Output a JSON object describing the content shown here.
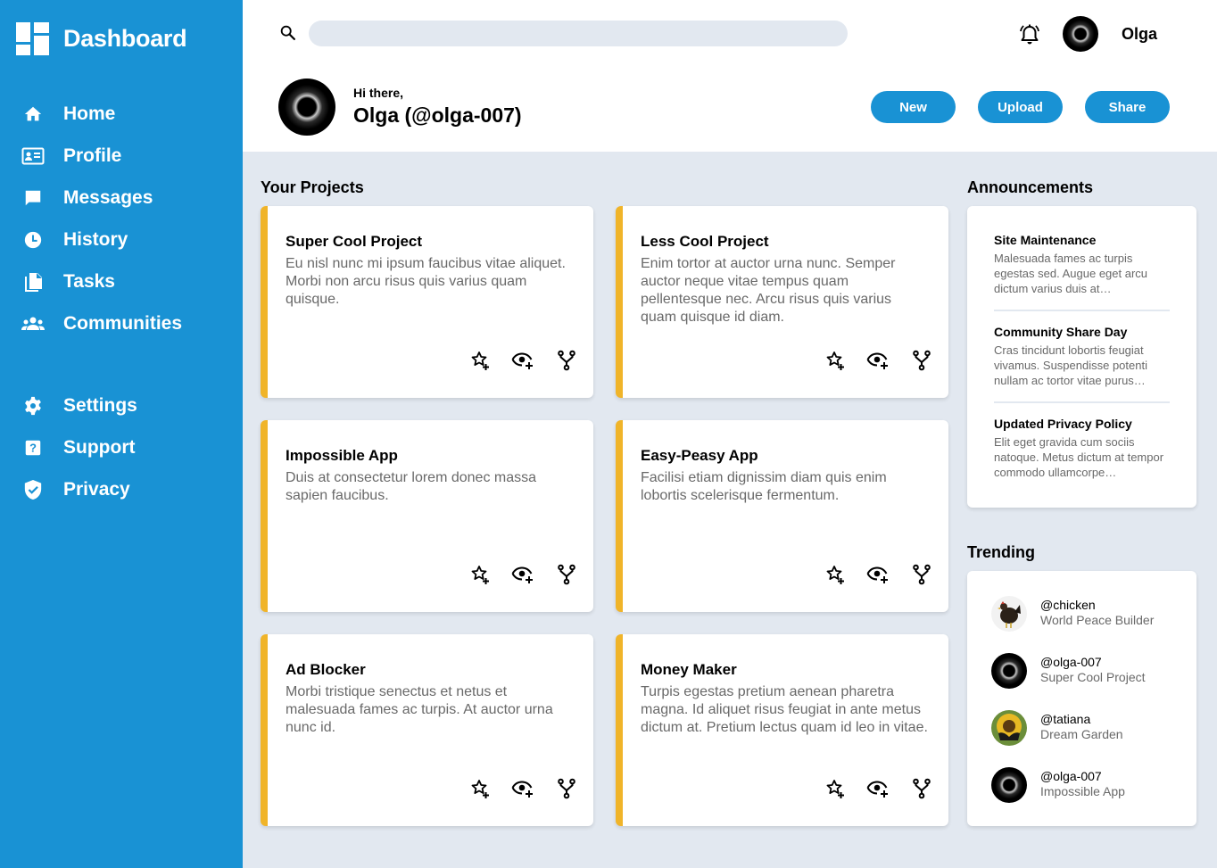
{
  "sidebar": {
    "brand": "Dashboard",
    "primary_items": [
      {
        "label": "Home",
        "icon": "home-icon"
      },
      {
        "label": "Profile",
        "icon": "id-card-icon"
      },
      {
        "label": "Messages",
        "icon": "message-icon"
      },
      {
        "label": "History",
        "icon": "clock-icon"
      },
      {
        "label": "Tasks",
        "icon": "documents-icon"
      },
      {
        "label": "Communities",
        "icon": "people-icon"
      }
    ],
    "secondary_items": [
      {
        "label": "Settings",
        "icon": "gear-icon"
      },
      {
        "label": "Support",
        "icon": "help-icon"
      },
      {
        "label": "Privacy",
        "icon": "shield-icon"
      }
    ]
  },
  "header": {
    "search_placeholder": "",
    "username": "Olga",
    "greeting": "Hi there,",
    "full_name": "Olga (@olga-007)",
    "buttons": [
      "New",
      "Upload",
      "Share"
    ]
  },
  "projects": {
    "title": "Your Projects",
    "items": [
      {
        "title": "Super Cool Project",
        "description": "Eu nisl nunc mi ipsum faucibus vitae aliquet. Morbi non arcu risus quis varius quam quisque."
      },
      {
        "title": "Less Cool Project",
        "description": "Enim tortor at auctor urna nunc. Semper auctor neque vitae tempus quam pellentesque nec. Arcu risus quis varius quam quisque id diam."
      },
      {
        "title": "Impossible App",
        "description": "Duis at consectetur lorem donec massa sapien faucibus."
      },
      {
        "title": "Easy-Peasy App",
        "description": "Facilisi etiam dignissim diam quis enim lobortis scelerisque fermentum."
      },
      {
        "title": "Ad Blocker",
        "description": "Morbi tristique senectus et netus et malesuada fames ac turpis. At auctor urna nunc id."
      },
      {
        "title": "Money Maker",
        "description": "Turpis egestas pretium aenean pharetra magna. Id aliquet risus feugiat in ante metus dictum at. Pretium lectus quam id leo in vitae."
      }
    ],
    "action_icons": [
      "star-plus-icon",
      "eye-plus-icon",
      "fork-icon"
    ]
  },
  "announcements": {
    "title": "Announcements",
    "items": [
      {
        "title": "Site Maintenance",
        "text": "Malesuada fames ac turpis egestas sed. Augue eget arcu dictum varius duis at…"
      },
      {
        "title": "Community Share Day",
        "text": "Cras tincidunt lobortis feugiat vivamus. Suspendisse potenti nullam ac tortor vitae purus…"
      },
      {
        "title": "Updated Privacy Policy",
        "text": "Elit eget gravida cum sociis natoque. Metus dictum at tempor commodo ullamcorpe…"
      }
    ]
  },
  "trending": {
    "title": "Trending",
    "items": [
      {
        "handle": "@chicken",
        "subtitle": "World Peace Builder",
        "avatar": "chicken-avatar"
      },
      {
        "handle": "@olga-007",
        "subtitle": "Super Cool Project",
        "avatar": "eclipse-avatar"
      },
      {
        "handle": "@tatiana",
        "subtitle": "Dream Garden",
        "avatar": "sunflower-avatar"
      },
      {
        "handle": "@olga-007",
        "subtitle": "Impossible App",
        "avatar": "eclipse-avatar"
      }
    ]
  },
  "colors": {
    "sidebar": "#1992d4",
    "accent": "#1992d4",
    "card_border": "#f0b429",
    "background": "#e2e8f0",
    "muted_text": "#696969"
  }
}
